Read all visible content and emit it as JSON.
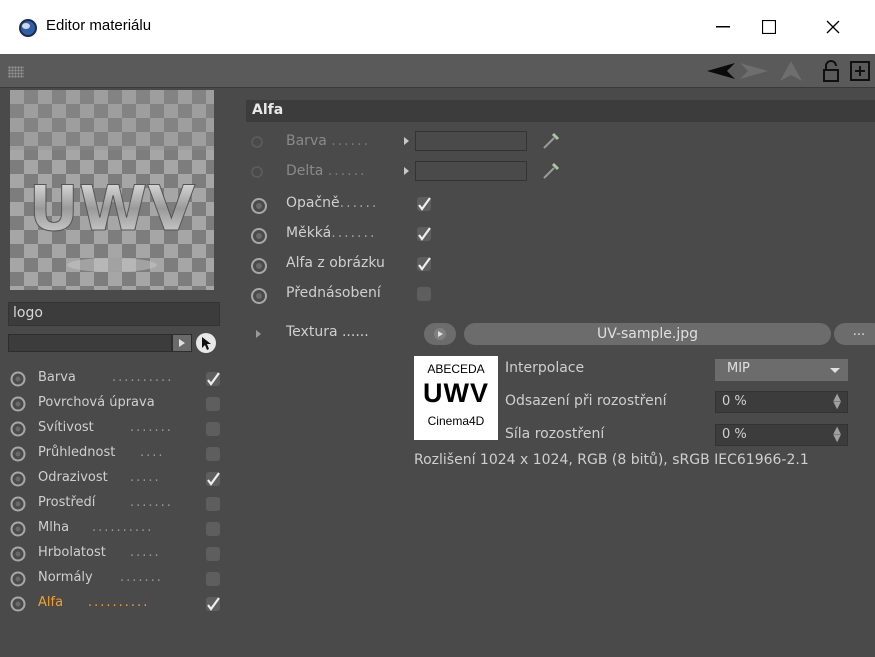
{
  "window": {
    "title": "Editor materiálu",
    "minimize_glyph": "—",
    "maximize_glyph": "☐",
    "close_glyph": "✕"
  },
  "toolbar": {
    "icons": [
      "grip-icon",
      "back-arrow-icon",
      "forward-arrow-icon",
      "up-arrow-icon",
      "lock-icon",
      "new-window-icon"
    ]
  },
  "preview": {
    "logo_text": "UWV"
  },
  "material": {
    "name": "logo"
  },
  "channels": [
    {
      "label": "Barva",
      "dots": "..........",
      "checked": true,
      "active": false
    },
    {
      "label": "Povrchová úprava",
      "dots": "",
      "checked": false,
      "active": false
    },
    {
      "label": "Svítivost",
      "dots": ".......",
      "checked": false,
      "active": false
    },
    {
      "label": "Průhlednost",
      "dots": "....",
      "checked": false,
      "active": false
    },
    {
      "label": "Odrazivost",
      "dots": ".....",
      "checked": true,
      "active": false
    },
    {
      "label": "Prostředí",
      "dots": ".......",
      "checked": false,
      "active": false
    },
    {
      "label": "Mlha",
      "dots": "..........",
      "checked": false,
      "active": false
    },
    {
      "label": "Hrbolatost",
      "dots": ".....",
      "checked": false,
      "active": false
    },
    {
      "label": "Normály",
      "dots": ".......",
      "checked": false,
      "active": false
    },
    {
      "label": "Alfa",
      "dots": "..........",
      "checked": true,
      "active": true
    }
  ],
  "section": {
    "title": "Alfa"
  },
  "alpha_props": {
    "barva": {
      "label": "Barva",
      "dots": "......"
    },
    "delta": {
      "label": "Delta",
      "dots": "......"
    },
    "opacne": {
      "label": "Opačně",
      "dots": "......",
      "checked": true
    },
    "mekka": {
      "label": "Měkká",
      "dots": ".......",
      "checked": true
    },
    "alfa_z_obrazku": {
      "label": "Alfa z obrázku",
      "checked": true
    },
    "prednasobeni": {
      "label": "Přednásobení",
      "checked": false
    }
  },
  "texture": {
    "label": "Textura",
    "dots": "......",
    "file": "UV-sample.jpg",
    "more_button": "...",
    "thumb_line1": "ABECEDA",
    "thumb_line2": "UWV",
    "thumb_line3": "Cinema4D",
    "interpolation_label": "Interpolace",
    "interpolation_value": "MIP",
    "blur_offset_label": "Odsazení při rozostření",
    "blur_offset_value": "0 %",
    "blur_strength_label": "Síla rozostření",
    "blur_strength_value": "0 %",
    "resolution_info": "Rozlišení 1024 x 1024, RGB (8 bitů), sRGB IEC61966-2.1"
  },
  "colors": {
    "active_channel": "#f0a030",
    "panel_bg": "#4a4a4a",
    "field_bg": "#3c3c3c",
    "button_bg": "#6c6c6c"
  }
}
